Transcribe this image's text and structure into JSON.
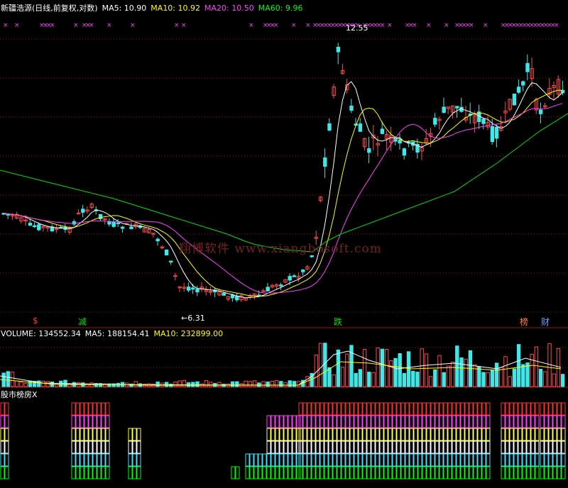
{
  "chart_data": {
    "type": "candlestick",
    "header": {
      "title": "新疆浩源(日线,前复权,对数)",
      "ma5": "MA5: 10.90",
      "ma10": "MA10: 10.92",
      "ma20": "MA20: 10.50",
      "ma60": "MA60: 9.96"
    },
    "annotations": {
      "high": "12.55",
      "low": "6.31"
    },
    "signals": [
      "$",
      "减",
      "跌",
      "榜",
      "财"
    ],
    "volume_header": {
      "volume": "VOLUME: 134552.34",
      "ma5": "MA5: 188154.41",
      "ma10": "MA10: 232899.00"
    },
    "indicator_title": "股市榜房X",
    "watermark": "翔博软件 www.xiangbosoft.com",
    "colors": {
      "up": "#ff4a4a",
      "down": "#3fe8e8",
      "ma5": "#ffffff",
      "ma10": "#ffff00",
      "ma20": "#ff40ff",
      "ma60": "#00e000",
      "grid": "#8b1a1a"
    }
  }
}
